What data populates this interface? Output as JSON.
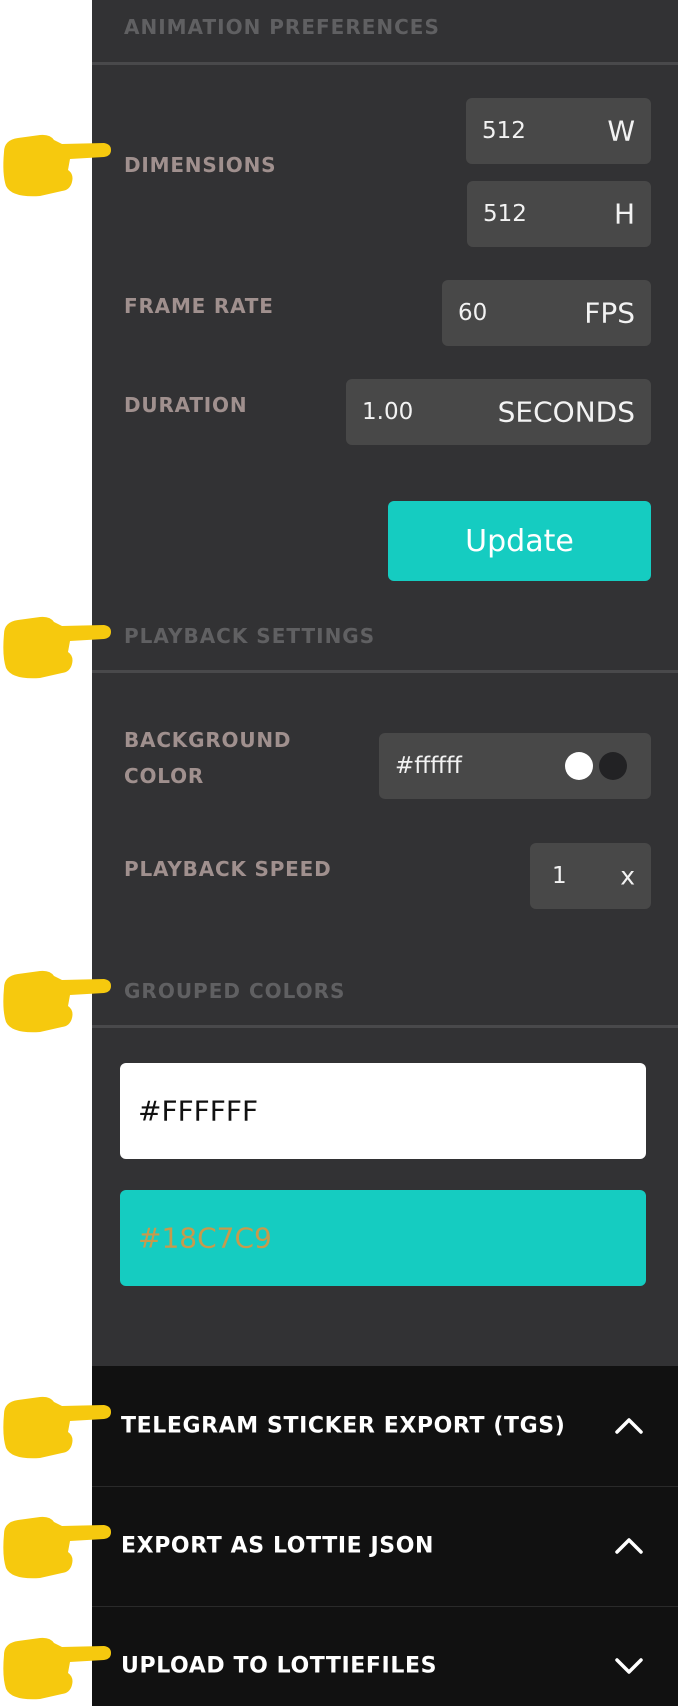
{
  "animation_preferences": {
    "header": "ANIMATION PREFERENCES",
    "dimensions_label": "DIMENSIONS",
    "width_value": "512",
    "width_unit": "W",
    "height_value": "512",
    "height_unit": "H",
    "frame_rate_label": "FRAME RATE",
    "frame_rate_value": "60",
    "frame_rate_unit": "FPS",
    "duration_label": "DURATION",
    "duration_value": "1.00",
    "duration_unit": "SECONDS",
    "update_label": "Update"
  },
  "playback_settings": {
    "header": "PLAYBACK SETTINGS",
    "background_color_label_line1": "BACKGROUND",
    "background_color_label_line2": "COLOR",
    "background_color_value": "#ffffff",
    "playback_speed_label": "PLAYBACK SPEED",
    "playback_speed_value": "1",
    "playback_speed_unit": "x"
  },
  "grouped_colors": {
    "header": "GROUPED COLORS",
    "colors": [
      {
        "value": "#FFFFFF",
        "text_color": "#111111"
      },
      {
        "value": "#18C7C9",
        "text_color": "#c79a4c"
      }
    ]
  },
  "accordion": {
    "items": [
      {
        "label": "TELEGRAM STICKER EXPORT (TGS)",
        "chevron": "chevron-up-icon"
      },
      {
        "label": "EXPORT AS LOTTIE JSON",
        "chevron": "chevron-up-icon"
      },
      {
        "label": "UPLOAD TO LOTTIEFILES",
        "chevron": "chevron-down-icon"
      }
    ]
  },
  "colors": {
    "panel_bg": "#323234",
    "accent": "#15ccc1",
    "accordion_bg": "#111111",
    "pointer_hand": "#f6c90e"
  }
}
